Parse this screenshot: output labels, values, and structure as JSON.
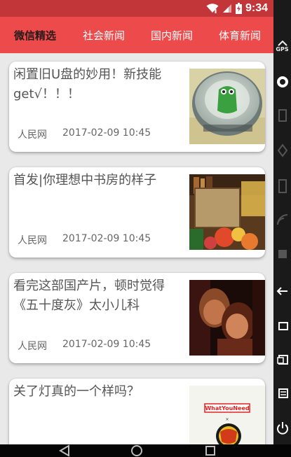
{
  "status_bar": {
    "time": "9:34",
    "icons": [
      "wifi-icon",
      "cell-signal-icon",
      "battery-icon"
    ]
  },
  "tabs": [
    {
      "label": "微信精选",
      "active": true
    },
    {
      "label": "社会新闻",
      "active": false
    },
    {
      "label": "国内新闻",
      "active": false
    },
    {
      "label": "体育新闻",
      "active": false
    }
  ],
  "articles": [
    {
      "title": "闲置旧U盘的妙用！新技能get√！！！",
      "source": "人民网",
      "date": "2017-02-09 10:45",
      "thumb": "usb-tin-photo"
    },
    {
      "title": "首发|你理想中书房的样子",
      "source": "人民网",
      "date": "2017-02-09 10:45",
      "thumb": "bookshelf-photo"
    },
    {
      "title": "看完这部国产片，顿时觉得《五十度灰》太小儿科",
      "source": "人民网",
      "date": "2017-02-09 10:45",
      "thumb": "film-still-photo"
    },
    {
      "title": "关了灯真的一个样吗？",
      "source": "",
      "date": "",
      "thumb": "whatyouneed-logo"
    }
  ],
  "thumb_text": {
    "whatyouneed": "WhatYouNeed"
  },
  "side_panel": {
    "gps_label": "GPS",
    "icons": [
      "gps-icon",
      "camera-icon",
      "record-icon",
      "device-icon",
      "rotate-icon",
      "volume-icon",
      "wireless-icon",
      "apps-icon",
      "back-icon",
      "home-icon",
      "recents-icon",
      "power-icon"
    ]
  },
  "nav_bar": {
    "icons": [
      "nav-back-icon",
      "nav-home-icon",
      "nav-recents-icon"
    ]
  },
  "colors": {
    "status_bar": "#c2363a",
    "tab_bar": "#ec4a4b",
    "active_tab_text": "#2a1a1a",
    "background": "#e9e9e9"
  }
}
